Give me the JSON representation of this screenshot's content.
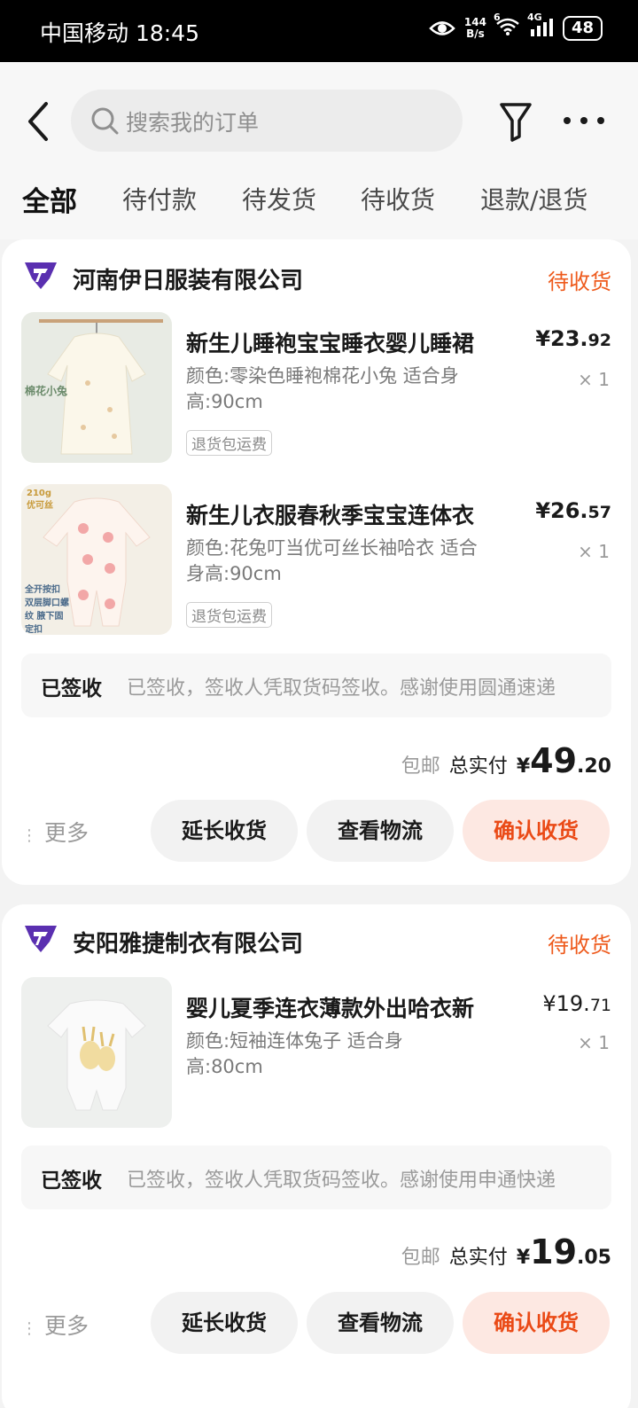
{
  "status_bar": {
    "carrier_time": "中国移动 18:45",
    "net_speed_value": "144",
    "net_speed_unit": "B/s",
    "wifi_label": "6",
    "signal_label": "4G",
    "battery": "48"
  },
  "header": {
    "search_placeholder": "搜索我的订单"
  },
  "tabs": [
    {
      "label": "全部",
      "active": true
    },
    {
      "label": "待付款"
    },
    {
      "label": "待发货"
    },
    {
      "label": "待收货"
    },
    {
      "label": "退款/退货"
    }
  ],
  "orders": [
    {
      "shop": "河南伊日服装有限公司",
      "status": "待收货",
      "items": [
        {
          "title": "新生儿睡袍宝宝睡衣婴儿睡裙",
          "spec": "颜色:零染色睡袍棉花小兔 适合身高:90cm",
          "tag": "退货包运费",
          "price_int": "¥23.",
          "price_dec": "92",
          "qty": "× 1",
          "thumb_text": "棉花小兔"
        },
        {
          "title": "新生儿衣服春秋季宝宝连体衣",
          "spec": "颜色:花兔叮当优可丝长袖哈衣 适合身高:90cm",
          "tag": "退货包运费",
          "price_int": "¥26.",
          "price_dec": "57",
          "qty": "× 1",
          "thumb_text_top": "210g 优可丝",
          "thumb_text_bottom": "全开按扣 双层脚口螺纹 腋下固定扣"
        }
      ],
      "logistics_status": "已签收",
      "logistics_desc": "已签收，签收人凭取货码签收。感谢使用圆通速递",
      "free_shipping": "包邮",
      "total_label": "总实付",
      "total_yen": "¥",
      "total_int": "49",
      "total_dec": ".20",
      "more": "更多",
      "buttons": [
        "延长收货",
        "查看物流",
        "确认收货"
      ]
    },
    {
      "shop": "安阳雅捷制衣有限公司",
      "status": "待收货",
      "items": [
        {
          "title": "婴儿夏季连衣薄款外出哈衣新",
          "spec": "颜色:短袖连体兔子 适合身高:80cm",
          "price_int": "¥19.",
          "price_dec": "71",
          "qty": "× 1"
        }
      ],
      "logistics_status": "已签收",
      "logistics_desc": "已签收，签收人凭取货码签收。感谢使用申通快递",
      "free_shipping": "包邮",
      "total_label": "总实付",
      "total_yen": "¥",
      "total_int": "19",
      "total_dec": ".05",
      "more": "更多",
      "buttons": [
        "延长收货",
        "查看物流",
        "确认收货"
      ]
    }
  ],
  "colors": {
    "accent": "#ee5a1c",
    "shop_icon": "#5a2fb0",
    "primary_button_bg": "#fde8e2"
  }
}
